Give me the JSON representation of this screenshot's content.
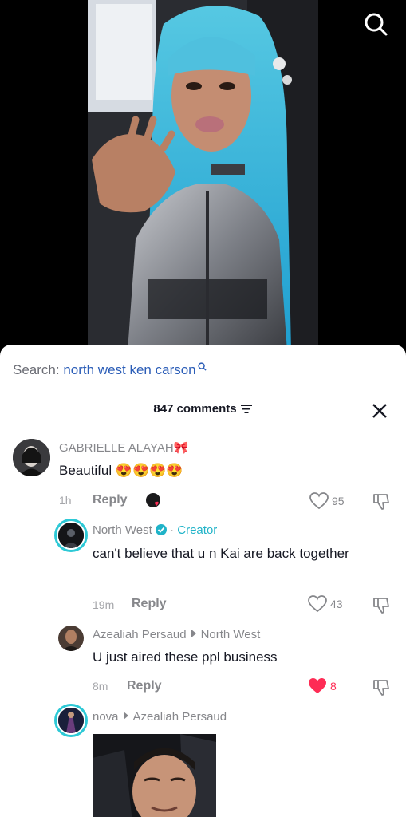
{
  "search": {
    "prefix": "Search:",
    "query": "north west ken carson"
  },
  "comments_header": {
    "count_label": "847 comments"
  },
  "comments": [
    {
      "username": "GABRIELLE ALAYAH",
      "username_emoji": "🎀",
      "text": "Beautiful 😍😍😍😍",
      "time": "1h",
      "reply_label": "Reply",
      "likes": "95",
      "liked": false
    },
    {
      "username": "North West",
      "badge": "Creator",
      "badge_separator": "·",
      "text": "can't believe that u n Kai are back together",
      "time": "19m",
      "reply_label": "Reply",
      "likes": "43",
      "liked": false
    },
    {
      "username": "Azealiah Persaud",
      "reply_to": "North West",
      "text": "U just aired these ppl business",
      "time": "8m",
      "reply_label": "Reply",
      "likes": "8",
      "liked": true
    },
    {
      "username": "nova",
      "reply_to": "Azealiah Persaud"
    }
  ],
  "colors": {
    "accent_teal": "#2ec9d6",
    "link_blue": "#2b5db7",
    "like_red": "#fe2c55",
    "hair_blue": "#3fb6d4"
  }
}
